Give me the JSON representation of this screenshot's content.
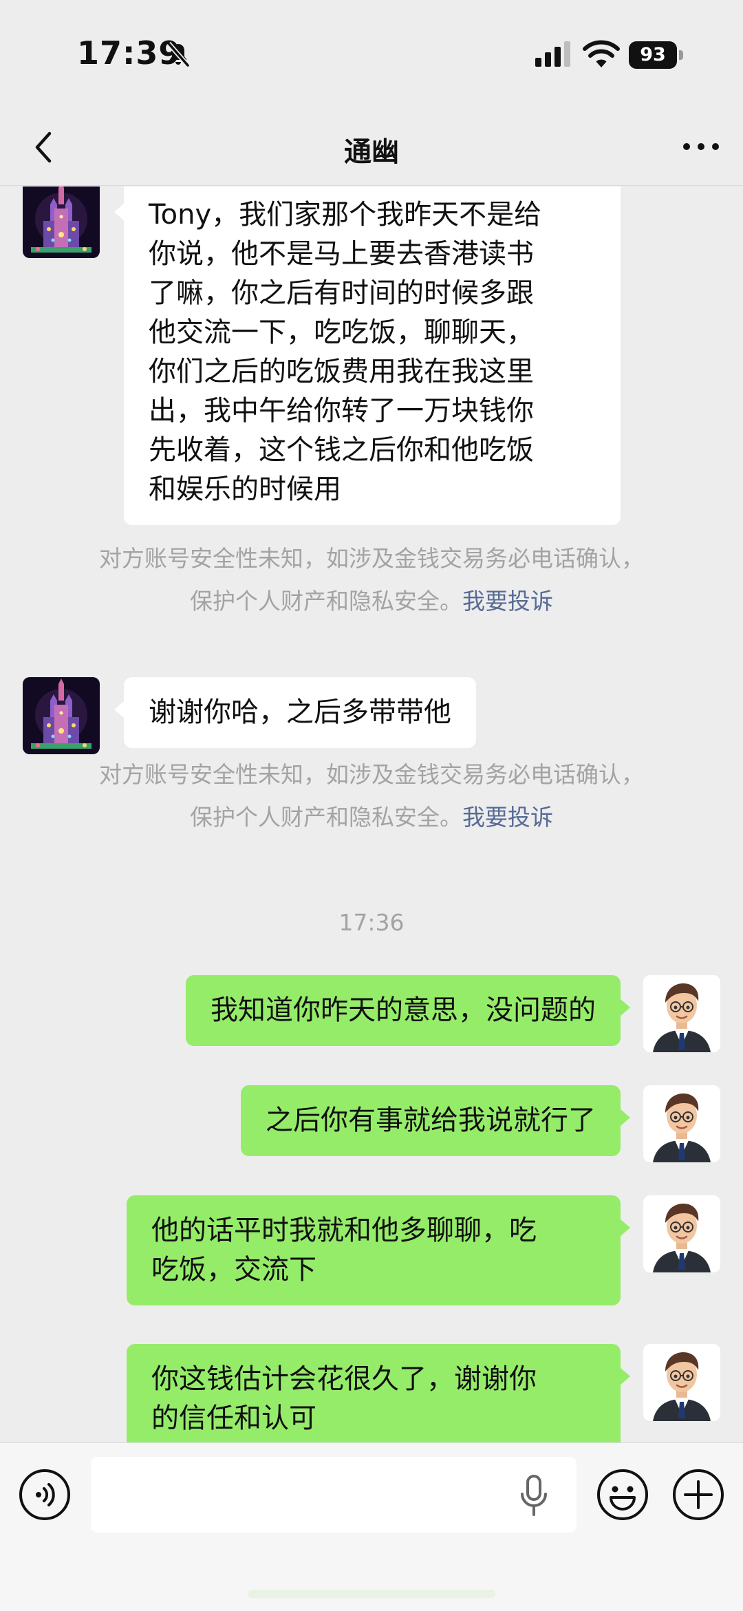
{
  "status_bar": {
    "time": "17:39",
    "battery": "93"
  },
  "nav": {
    "title": "通幽"
  },
  "messages": {
    "m1": "Tony，我们家那个我昨天不是给\n你说，他不是马上要去香港读书\n了嘛，你之后有时间的时候多跟\n他交流一下，吃吃饭，聊聊天，\n你们之后的吃饭费用我在我这里\n出，我中午给你转了一万块钱你\n先收着，这个钱之后你和他吃饭\n和娱乐的时候用",
    "m2": "谢谢你哈，之后多带带他",
    "m3": "我知道你昨天的意思，没问题的",
    "m4": "之后你有事就给我说就行了",
    "m5": "他的话平时我就和他多聊聊，吃\n吃饭，交流下",
    "m6": "你这钱估计会花很久了，谢谢你\n的信任和认可"
  },
  "notice": {
    "line1": "对方账号安全性未知，如涉及金钱交易务必电话确认，",
    "line2": "保护个人财产和隐私安全。",
    "link": "我要投诉"
  },
  "timestamp": "17:36",
  "input": {
    "value": ""
  },
  "colors": {
    "background": "#ededed",
    "outgoing_bubble": "#95ec69",
    "incoming_bubble": "#ffffff",
    "link": "#576b95"
  },
  "icons": [
    "mute-icon",
    "signal-icon",
    "wifi-icon",
    "back-icon",
    "more-icon",
    "voice-icon",
    "mic-icon",
    "emoji-icon",
    "add-icon"
  ]
}
